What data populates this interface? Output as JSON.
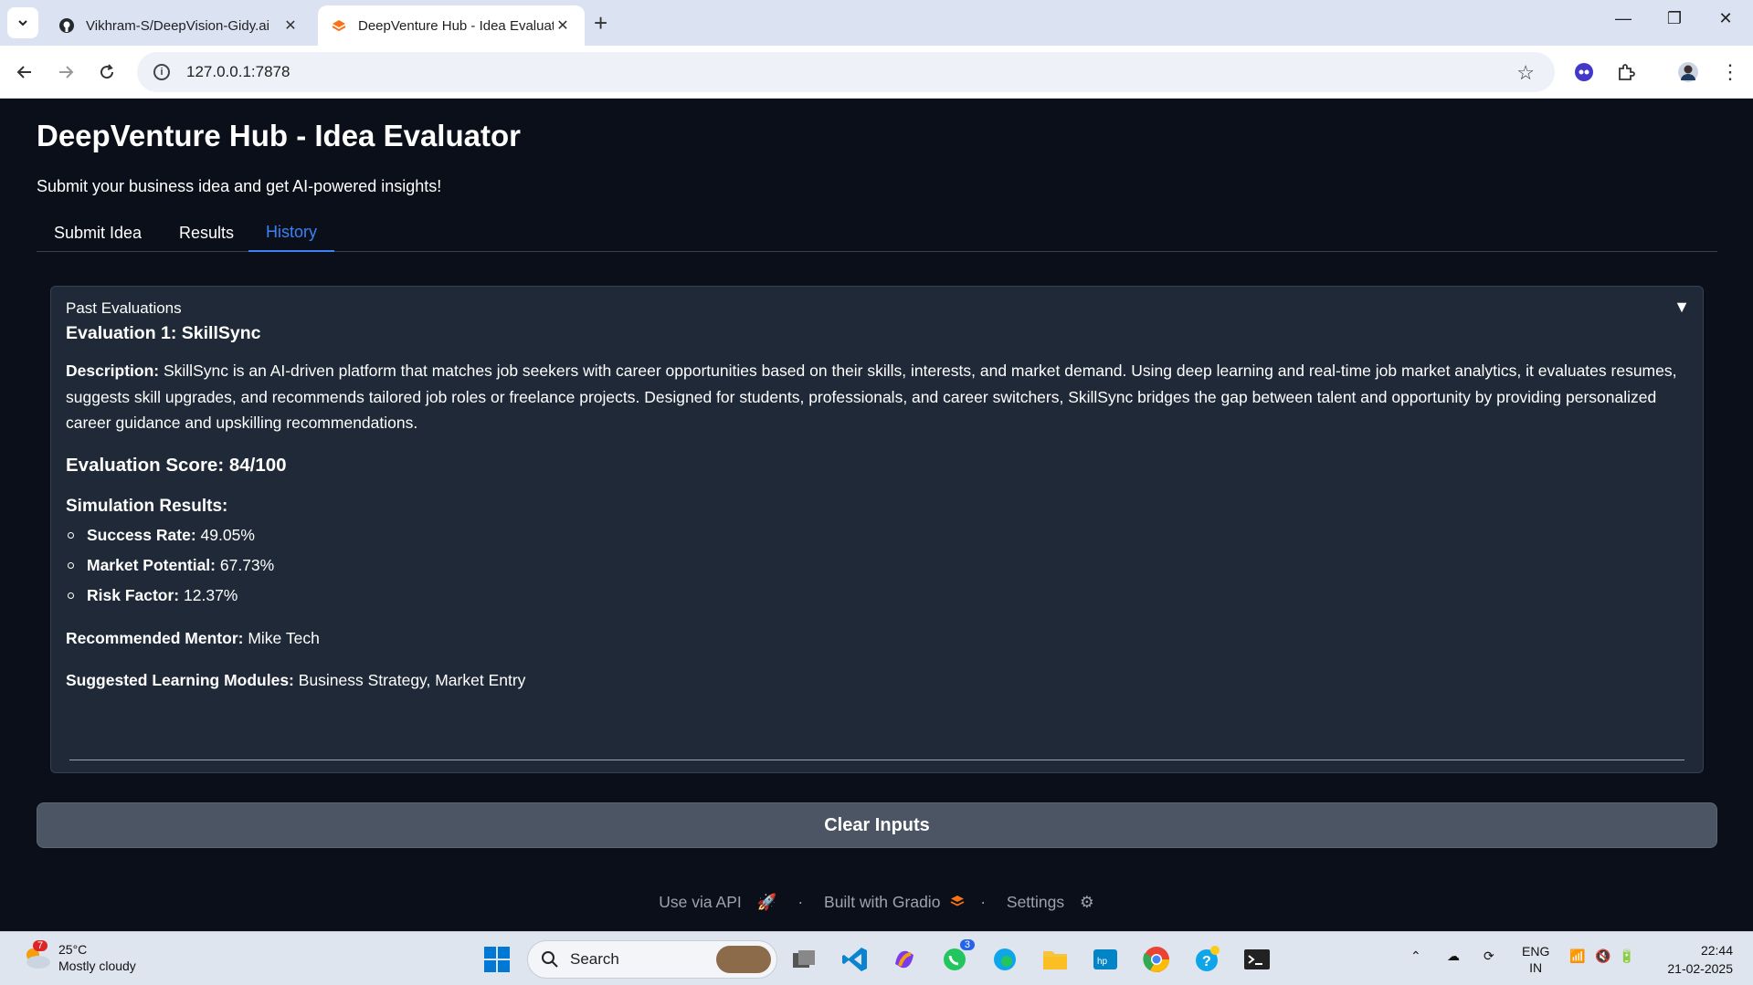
{
  "browser": {
    "tabs": [
      {
        "title": "Vikhram-S/DeepVision-Gidy.ai",
        "icon": "github-icon"
      },
      {
        "title": "DeepVenture Hub - Idea Evaluator",
        "icon": "gradio-icon"
      }
    ],
    "url": "127.0.0.1:7878"
  },
  "app": {
    "title": "DeepVenture Hub - Idea Evaluator",
    "subtitle": "Submit your business idea and get AI-powered insights!",
    "tabs": [
      {
        "label": "Submit Idea"
      },
      {
        "label": "Results"
      },
      {
        "label": "History"
      }
    ],
    "active_tab": "History"
  },
  "history": {
    "panel_label": "Past Evaluations",
    "toggle_symbol": "▼",
    "evaluation": {
      "heading": "Evaluation 1: SkillSync",
      "description_label": "Description:",
      "description": "SkillSync is an AI-driven platform that matches job seekers with career opportunities based on their skills, interests, and market demand. Using deep learning and real-time job market analytics, it evaluates resumes, suggests skill upgrades, and recommends tailored job roles or freelance projects. Designed for students, professionals, and career switchers, SkillSync bridges the gap between talent and opportunity by providing personalized career guidance and upskilling recommendations.",
      "score": "Evaluation Score: 84/100",
      "simulation_heading": "Simulation Results:",
      "simulation": [
        {
          "label": "Success Rate:",
          "value": "49.05%"
        },
        {
          "label": "Market Potential:",
          "value": "67.73%"
        },
        {
          "label": "Risk Factor:",
          "value": "12.37%"
        }
      ],
      "mentor_label": "Recommended Mentor:",
      "mentor": "Mike Tech",
      "modules_label": "Suggested Learning Modules:",
      "modules": "Business Strategy, Market Entry"
    }
  },
  "clear_button": "Clear Inputs",
  "footer": {
    "api": "Use via API",
    "built": "Built with Gradio",
    "settings": "Settings",
    "sep": "·"
  },
  "taskbar": {
    "weather_temp": "25°C",
    "weather_desc": "Mostly cloudy",
    "weather_badge": "7",
    "search_label": "Search",
    "whatsapp_badge": "3",
    "lang_top": "ENG",
    "lang_bottom": "IN",
    "time": "22:44",
    "date": "21-02-2025"
  },
  "colors": {
    "accent": "#3b82f6",
    "page_bg": "#0b0f19",
    "panel_bg": "#1f2937",
    "button_bg": "#4b5563"
  }
}
